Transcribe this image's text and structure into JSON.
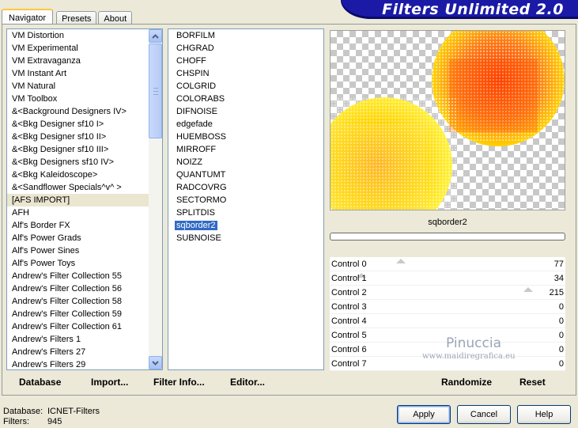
{
  "app_title": "Filters Unlimited 2.0",
  "tabs": [
    "Navigator",
    "Presets",
    "About"
  ],
  "categories": [
    "VM Distortion",
    "VM Experimental",
    "VM Extravaganza",
    "VM Instant Art",
    "VM Natural",
    "VM Toolbox",
    "&<Background Designers IV>",
    "&<Bkg Designer sf10 I>",
    "&<Bkg Designer sf10 II>",
    "&<Bkg Designer sf10 III>",
    "&<Bkg Designers sf10 IV>",
    "&<Bkg Kaleidoscope>",
    "&<Sandflower Specials^v^ >",
    "[AFS IMPORT]",
    "AFH",
    "Alf's Border FX",
    "Alf's Power Grads",
    "Alf's Power Sines",
    "Alf's Power Toys",
    "Andrew's Filter Collection 55",
    "Andrew's Filter Collection 56",
    "Andrew's Filter Collection 58",
    "Andrew's Filter Collection 59",
    "Andrew's Filter Collection 61",
    "Andrew's Filters 1",
    "Andrew's Filters 27",
    "Andrew's Filters 29"
  ],
  "selected_category": "[AFS IMPORT]",
  "filters": [
    "BORFILM",
    "CHGRAD",
    "CHOFF",
    "CHSPIN",
    "COLGRID",
    "COLORABS",
    "DIFNOISE",
    "edgefade",
    "HUEMBOSS",
    "MIRROFF",
    "NOIZZ",
    "QUANTUMT",
    "RADCOVRG",
    "SECTORMO",
    "SPLITDIS",
    "sqborder2",
    "SUBNOISE"
  ],
  "selected_filter": "sqborder2",
  "preview_name": "sqborder2",
  "controls": [
    {
      "label": "Control 0",
      "value": "77"
    },
    {
      "label": "Control 1",
      "value": "34"
    },
    {
      "label": "Control 2",
      "value": "215"
    },
    {
      "label": "Control 3",
      "value": "0"
    },
    {
      "label": "Control 4",
      "value": "0"
    },
    {
      "label": "Control 5",
      "value": "0"
    },
    {
      "label": "Control 6",
      "value": "0"
    },
    {
      "label": "Control 7",
      "value": "0"
    }
  ],
  "control_levels": [
    0.302,
    0.133,
    0.843,
    0,
    0,
    0,
    0,
    0
  ],
  "watermark": {
    "line1": "Pinuccia",
    "line2": "www.maidiregrafica.eu"
  },
  "bottom_links": {
    "database": "Database",
    "import": "Import...",
    "filter_info": "Filter Info...",
    "editor": "Editor...",
    "randomize": "Randomize",
    "reset": "Reset"
  },
  "status": {
    "database_label": "Database:",
    "database_value": "ICNET-Filters",
    "filters_label": "Filters:",
    "filters_value": "945"
  },
  "buttons": {
    "apply": "Apply",
    "cancel": "Cancel",
    "help": "Help"
  },
  "colors": {
    "banner": "#1a1aa6",
    "selection": "#316ac5",
    "window": "#ece9d8"
  }
}
